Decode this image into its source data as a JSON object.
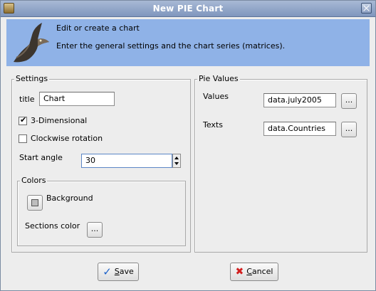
{
  "window": {
    "title": "New PIE Chart"
  },
  "banner": {
    "heading": "Edit or create a chart",
    "subtitle": "Enter the general settings and the chart series (matrices)."
  },
  "settings": {
    "group_label": "Settings",
    "title_label": "title",
    "title_value": "Chart",
    "three_d_label": "3-Dimensional",
    "three_d_checked": true,
    "clockwise_label": "Clockwise rotation",
    "clockwise_checked": false,
    "start_angle_label": "Start angle",
    "start_angle_value": "30",
    "colors": {
      "group_label": "Colors",
      "background_label": "Background",
      "background_color": "#bdbdbd",
      "sections_label": "Sections color",
      "browse_label": "..."
    }
  },
  "pie_values": {
    "group_label": "Pie Values",
    "values_label": "Values",
    "values_value": "data.july2005",
    "texts_label": "Texts",
    "texts_value": "data.Countries",
    "browse_label": "..."
  },
  "buttons": {
    "save_first": "S",
    "save_rest": "ave",
    "cancel_first": "C",
    "cancel_rest": "ancel"
  },
  "icons": {
    "app": "app-icon",
    "close": "close-icon",
    "banner": "bird-icon",
    "save": "checkmark-icon",
    "cancel": "red-x-icon"
  }
}
